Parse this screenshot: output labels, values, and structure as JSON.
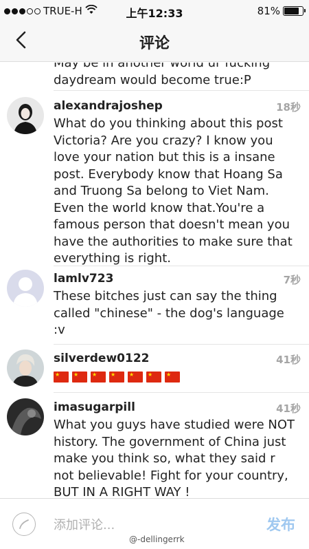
{
  "status_bar": {
    "carrier": "TRUE-H",
    "time": "上午12:33",
    "battery_percent": "81%",
    "battery_level": 0.81,
    "signal_dots_filled": 3,
    "signal_dots_total": 5
  },
  "nav": {
    "title": "评论",
    "back_icon": "chevron-left-icon"
  },
  "partial_comment": {
    "text": "May be in another world ur fucking daydream would become true:P"
  },
  "comments": [
    {
      "username": "alexandrajoshep",
      "time": "18秒",
      "text": "What do you thinking about this post Victoria? Are you crazy? I know you love your nation but this is a insane post. Everybody know that Hoang Sa and Truong Sa belong to Viet Nam. Even the world know that.You're a famous person that doesn't mean you have the authorities to make sure that everything is right."
    },
    {
      "username": "lamlv723",
      "time": "7秒",
      "text": "These bitches just can say the thing called \"chinese\" - the dog's language :v"
    },
    {
      "username": "silverdew0122",
      "time": "41秒",
      "flag_count": 7,
      "flag_icon": "china-flag-icon"
    },
    {
      "username": "imasugarpill",
      "time": "41秒",
      "text": "What you guys have studied were NOT history. The government of China just make you think so, what they said r not believable! Fight for your country, BUT IN A RIGHT WAY !"
    }
  ],
  "compose": {
    "placeholder": "添加评论...",
    "publish_label": "发布",
    "icon": "compose-circle-icon",
    "publish_color": "#9fc8f0"
  },
  "watermark": "@-dellingerrk"
}
